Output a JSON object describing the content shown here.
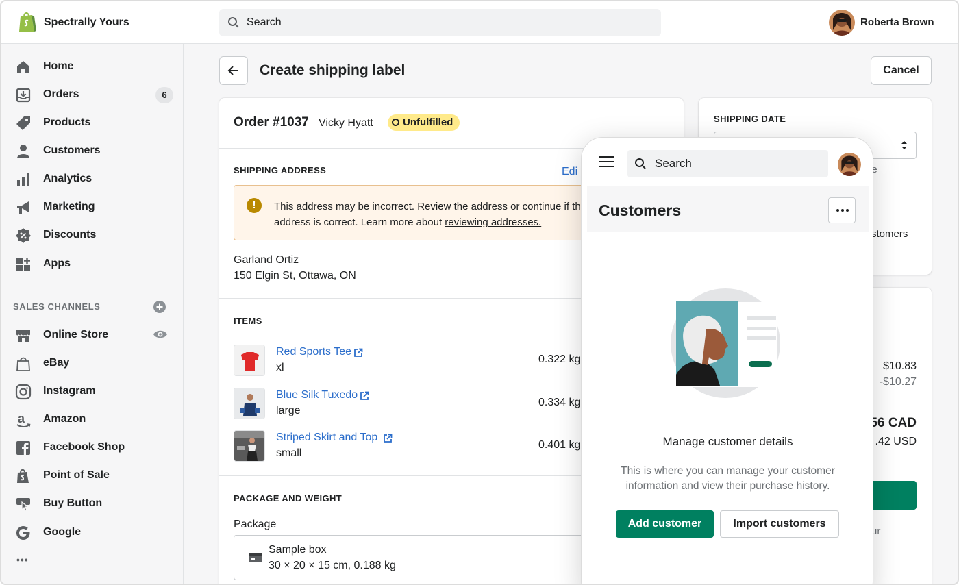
{
  "topbar": {
    "store_name": "Spectrally Yours",
    "search_placeholder": "Search",
    "user_name": "Roberta Brown",
    "logo_icon": "shopify-bag-icon"
  },
  "sidebar": {
    "items": [
      {
        "label": "Home",
        "icon": "home-icon"
      },
      {
        "label": "Orders",
        "icon": "orders-icon",
        "badge": "6"
      },
      {
        "label": "Products",
        "icon": "tag-icon"
      },
      {
        "label": "Customers",
        "icon": "person-icon"
      },
      {
        "label": "Analytics",
        "icon": "bar-chart-icon"
      },
      {
        "label": "Marketing",
        "icon": "megaphone-icon"
      },
      {
        "label": "Discounts",
        "icon": "discount-icon"
      },
      {
        "label": "Apps",
        "icon": "apps-icon"
      }
    ],
    "sales_channels_title": "SALES CHANNELS",
    "channels": [
      {
        "label": "Online Store",
        "icon": "store-icon"
      },
      {
        "label": "eBay",
        "icon": "shopping-bag-icon"
      },
      {
        "label": "Instagram",
        "icon": "instagram-icon"
      },
      {
        "label": "Amazon",
        "icon": "amazon-icon"
      },
      {
        "label": "Facebook Shop",
        "icon": "facebook-icon"
      },
      {
        "label": "Point of Sale",
        "icon": "pos-bag-icon"
      },
      {
        "label": "Buy Button",
        "icon": "buy-button-icon"
      },
      {
        "label": "Google",
        "icon": "google-icon"
      }
    ],
    "more": "•••"
  },
  "page": {
    "title": "Create shipping label",
    "cancel_label": "Cancel"
  },
  "order": {
    "number": "Order #1037",
    "customer": "Vicky Hyatt",
    "status": "Unfulfilled",
    "shipping_address_title": "SHIPPING ADDRESS",
    "edit_label": "Edi",
    "warning_text": "This address may be incorrect. Review the address or continue if the address is correct. Learn more about ",
    "warning_link": "reviewing addresses.",
    "address_name": "Garland Ortiz",
    "address_line": "150 Elgin St, Ottawa, ON",
    "items_title": "ITEMS",
    "items": [
      {
        "name": "Red Sports Tee",
        "variant": "xl",
        "weight": "0.322 kg"
      },
      {
        "name": "Blue Silk Tuxedo",
        "variant": "large",
        "weight": "0.334 kg"
      },
      {
        "name": "Striped Skirt and Top",
        "variant": "small",
        "weight": "0.401 kg"
      }
    ],
    "package_title": "PACKAGE AND WEIGHT",
    "package_label": "Package",
    "package_name": "Sample box",
    "package_dims": "30 × 20 × 15 cm, 0.188 kg"
  },
  "right": {
    "shipping_date_title": "SHIPPING DATE",
    "date_fragment": "ne",
    "customers_fragment": "stomers",
    "subtotal": "$10.83",
    "discount": "-$10.27",
    "total_cad": "56 CAD",
    "total_usd": ".42 USD",
    "footer_fragment": "ur"
  },
  "mobile": {
    "search_placeholder": "Search",
    "title": "Customers",
    "heading": "Manage customer details",
    "description": "This is where you can manage your customer information and view their purchase history.",
    "add_label": "Add customer",
    "import_label": "Import customers"
  },
  "colors": {
    "accent_green": "#008060",
    "link_blue": "#2c6ecb",
    "warning_bg": "#fff5ea",
    "badge_yellow": "#ffea8a"
  }
}
